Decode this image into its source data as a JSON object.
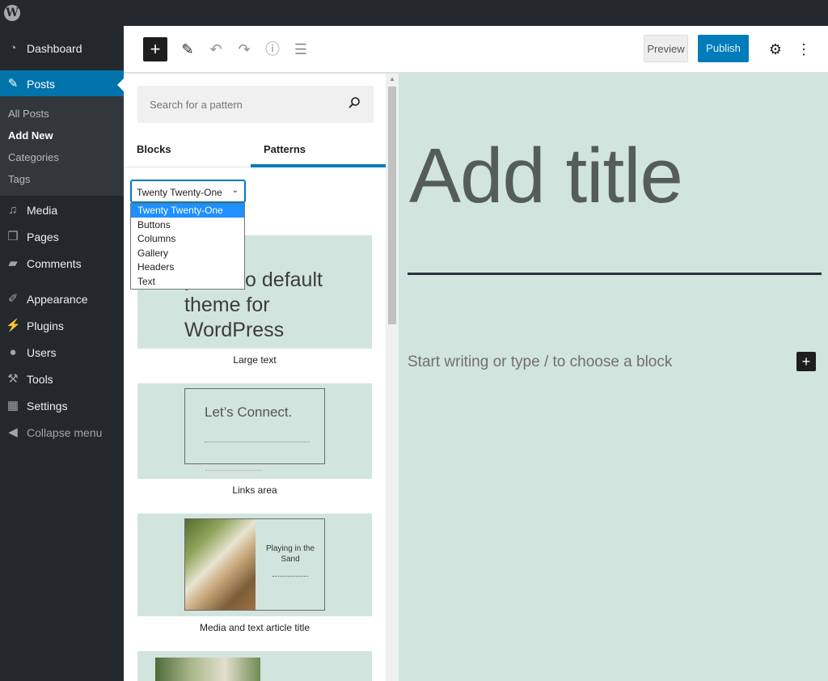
{
  "sidebar": {
    "items": [
      {
        "label": "Dashboard",
        "icon": "dashboard-icon"
      },
      {
        "label": "Posts",
        "icon": "pin-icon"
      },
      {
        "label": "Media",
        "icon": "media-icon"
      },
      {
        "label": "Pages",
        "icon": "pages-icon"
      },
      {
        "label": "Comments",
        "icon": "comments-icon"
      },
      {
        "label": "Appearance",
        "icon": "appearance-icon"
      },
      {
        "label": "Plugins",
        "icon": "plugins-icon"
      },
      {
        "label": "Users",
        "icon": "users-icon"
      },
      {
        "label": "Tools",
        "icon": "tools-icon"
      },
      {
        "label": "Settings",
        "icon": "settings-icon"
      },
      {
        "label": "Collapse menu",
        "icon": "collapse-icon"
      }
    ],
    "submenu": [
      "All Posts",
      "Add New",
      "Categories",
      "Tags"
    ]
  },
  "toolbar": {
    "preview_label": "Preview",
    "publish_label": "Publish"
  },
  "inserter": {
    "search_placeholder": "Search for a pattern",
    "tabs": [
      "Blocks",
      "Patterns"
    ],
    "category_selected": "Twenty Twenty-One",
    "category_options": [
      "Twenty Twenty-One",
      "Buttons",
      "Columns",
      "Gallery",
      "Headers",
      "Text"
    ],
    "patterns": [
      {
        "label": "Large text",
        "preview_text": "portfolio default theme for WordPress"
      },
      {
        "label": "Links area",
        "preview_text": "Let’s Connect."
      },
      {
        "label": "Media and text article title",
        "preview_text": "Playing in the Sand"
      }
    ]
  },
  "canvas": {
    "title_placeholder": "Add title",
    "body_placeholder": "Start writing or type / to choose a block"
  },
  "colors": {
    "accent": "#007cba",
    "sidebar_bg": "#23282d",
    "canvas_bg": "#d2e4de"
  }
}
